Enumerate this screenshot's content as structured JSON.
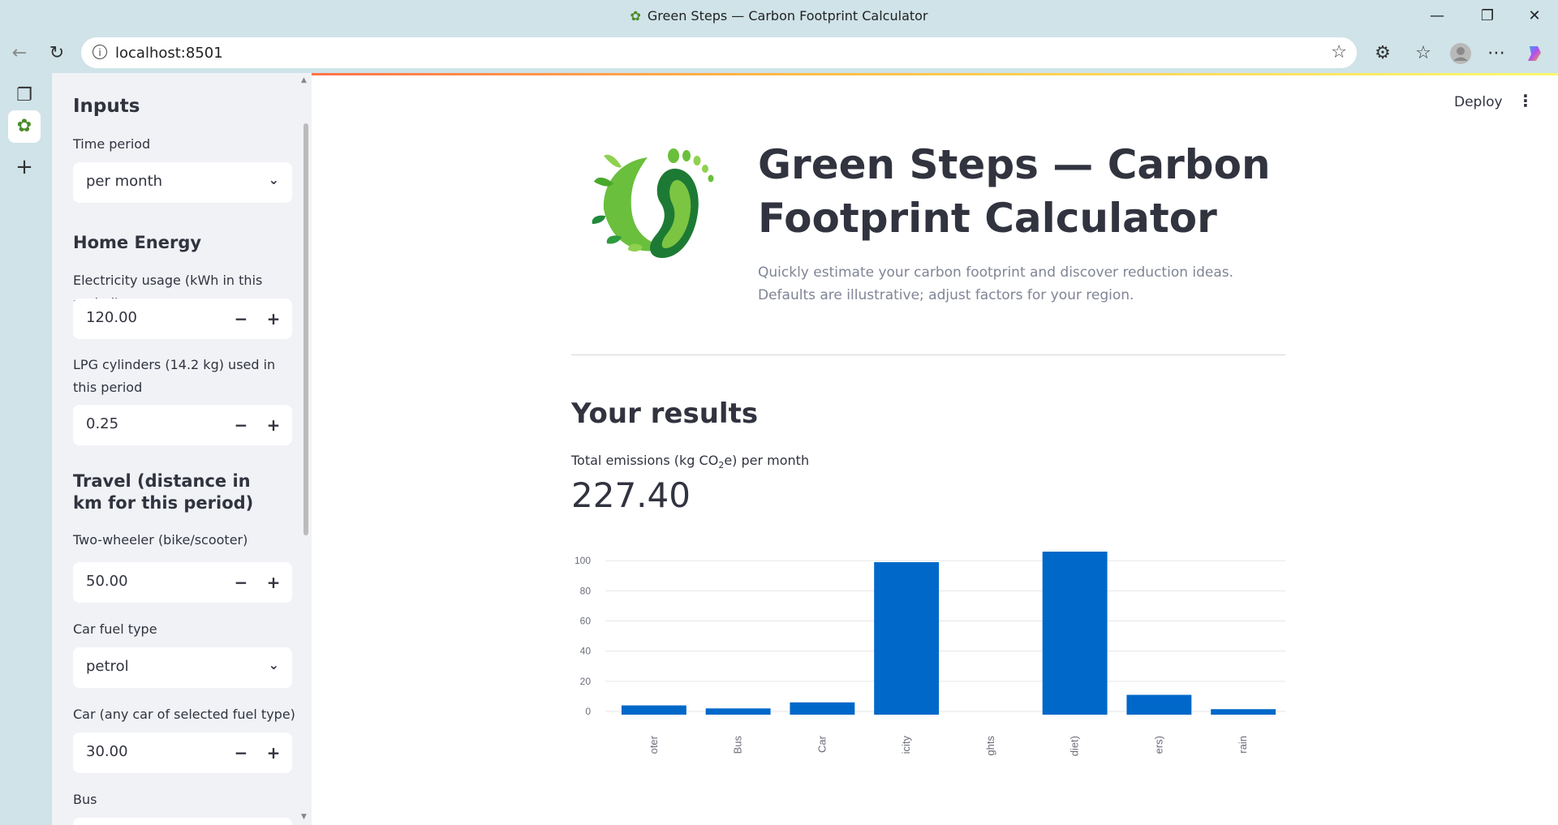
{
  "window": {
    "title": "Green Steps — Carbon Footprint Calculator",
    "url": "localhost:8501"
  },
  "header": {
    "deploy_label": "Deploy"
  },
  "sidebar": {
    "heading": "Inputs",
    "time_period_label": "Time period",
    "time_period_value": "per month",
    "home_energy_heading": "Home Energy",
    "electricity_label": "Electricity usage (kWh in this period)",
    "electricity_value": "120.00",
    "lpg_label": "LPG cylinders (14.2 kg) used in this period",
    "lpg_value": "0.25",
    "travel_heading": "Travel (distance in km for this period)",
    "two_wheeler_label": "Two-wheeler (bike/scooter)",
    "two_wheeler_value": "50.00",
    "car_fuel_label": "Car fuel type",
    "car_fuel_value": "petrol",
    "car_label": "Car (any car of selected fuel type)",
    "car_value": "30.00",
    "bus_label": "Bus"
  },
  "main": {
    "title": "Green Steps — Carbon Footprint Calculator",
    "subtitle": "Quickly estimate your carbon footprint and discover reduction ideas. Defaults are illustrative; adjust factors for your region.",
    "results_heading": "Your results",
    "metric_label_prefix": "Total emissions (kg CO",
    "metric_label_sub": "2",
    "metric_label_suffix": "e) per month",
    "metric_value": "227.40"
  },
  "chart_data": {
    "type": "bar",
    "categories": [
      "oter",
      "Bus",
      "Car",
      "icity",
      "ghts",
      "diet)",
      "ers)",
      "rain"
    ],
    "values": [
      4.0,
      2.0,
      6.0,
      99.0,
      0,
      106.0,
      11.0,
      1.5
    ],
    "yticks": [
      0,
      20,
      40,
      60,
      80,
      100
    ],
    "ylim": [
      0,
      106
    ],
    "bar_color": "#0068c9",
    "grid": true
  },
  "colors": {
    "accent": "#ff4b4b",
    "bar": "#0068c9",
    "text": "#31333f",
    "sidebar_bg": "#f0f2f6"
  }
}
